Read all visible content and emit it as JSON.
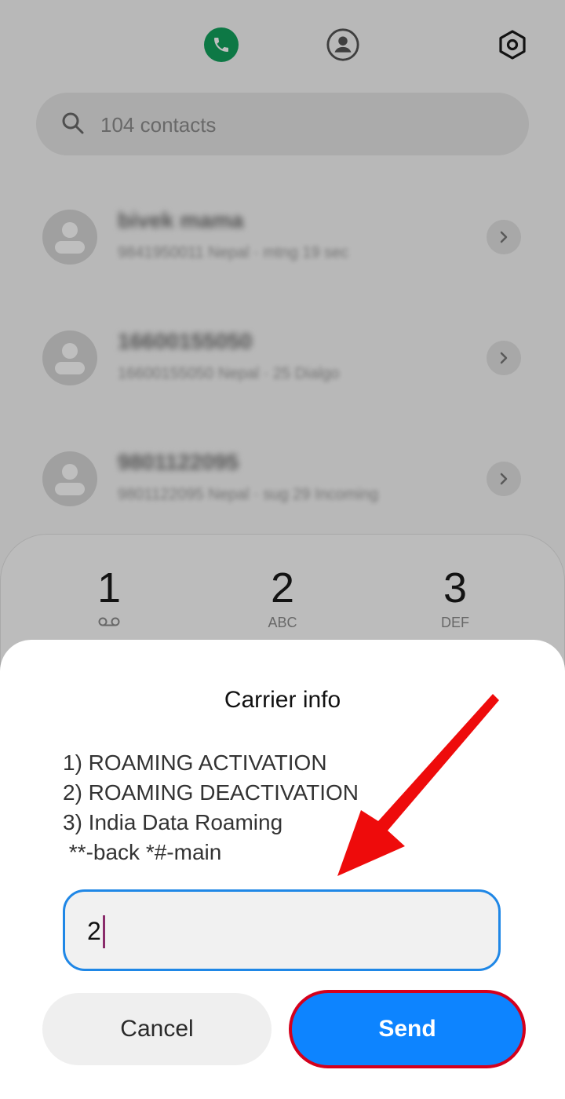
{
  "tabs": {
    "phone_icon": "phone-icon",
    "contacts_icon": "contacts-icon",
    "settings_icon": "settings-icon"
  },
  "search": {
    "placeholder": "104 contacts"
  },
  "contacts": [
    {
      "name": "bivek mama",
      "detail": "9841950011 Nepal · mtng 19 sec"
    },
    {
      "name": "16600155050",
      "detail": "16600155050 Nepal · 25 Dialgo"
    },
    {
      "name": "9801122095",
      "detail": "9801122095 Nepal · sug 29 Incoming"
    }
  ],
  "dialpad": [
    {
      "num": "1",
      "sub": ""
    },
    {
      "num": "2",
      "sub": "ABC"
    },
    {
      "num": "3",
      "sub": "DEF"
    }
  ],
  "dialog": {
    "title": "Carrier info",
    "message_lines": [
      "1) ROAMING ACTIVATION",
      "2) ROAMING DEACTIVATION",
      "3) India Data Roaming",
      " **-back *#-main"
    ],
    "input_value": "2",
    "cancel_label": "Cancel",
    "send_label": "Send"
  },
  "colors": {
    "accent": "#0d84ff",
    "phone_tab": "#12a05c",
    "highlight": "#d4001c"
  }
}
